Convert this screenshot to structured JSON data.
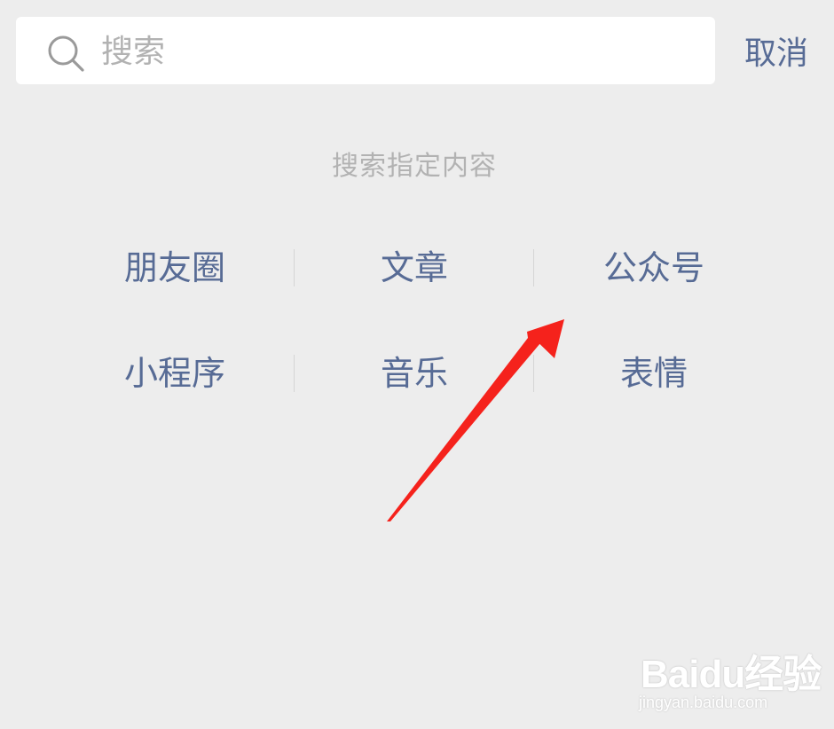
{
  "search": {
    "placeholder": "搜索",
    "value": "",
    "cancel_label": "取消"
  },
  "section_title": "搜索指定内容",
  "categories": [
    {
      "label": "朋友圈"
    },
    {
      "label": "文章"
    },
    {
      "label": "公众号"
    },
    {
      "label": "小程序"
    },
    {
      "label": "音乐"
    },
    {
      "label": "表情"
    }
  ],
  "annotation": {
    "icon": "red-arrow",
    "color": "#f5221c"
  },
  "watermark": {
    "logo": "Baidu经验",
    "url": "jingyan.baidu.com"
  },
  "colors": {
    "accent": "#576b95",
    "muted": "#b2b2b2",
    "background": "#ededed"
  }
}
